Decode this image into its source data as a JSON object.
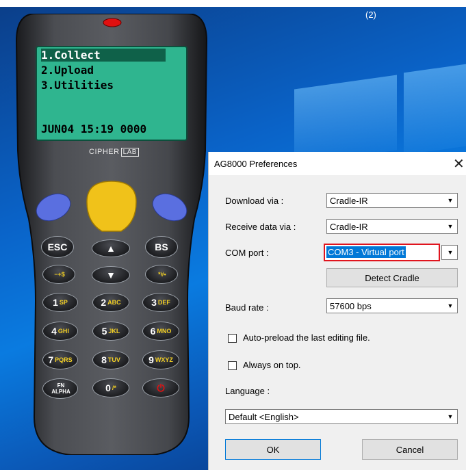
{
  "desktop": {
    "label_count": "(2)"
  },
  "device": {
    "menu": [
      "1.Collect",
      "2.Upload",
      "3.Utilities"
    ],
    "status_line": "JUN04 15:19 0000",
    "brand_name": "CIPHER",
    "brand_lab": "LAB",
    "keys": {
      "esc": "ESC",
      "bs": "BS",
      "minus": "−+$",
      "star": "*#•",
      "k1": "1",
      "k1s": "SP",
      "k2": "2",
      "k2s": "ABC",
      "k3": "3",
      "k3s": "DEF",
      "k4": "4",
      "k4s": "GHI",
      "k5": "5",
      "k5s": "JKL",
      "k6": "6",
      "k6s": "MNO",
      "k7": "7",
      "k7s": "PQRS",
      "k8": "8",
      "k8s": "TUV",
      "k9": "9",
      "k9s": "WXYZ",
      "fn": "FN ALPHA",
      "k0": "0",
      "k0s": "/*",
      "power": "⏻"
    }
  },
  "dialog": {
    "title": "AG8000 Preferences",
    "close": "✕",
    "download_label": "Download via :",
    "download_value": "Cradle-IR",
    "receive_label": "Receive data via :",
    "receive_value": "Cradle-IR",
    "com_label": "COM port :",
    "com_value": "COM3 - Virtual port",
    "detect_button": "Detect Cradle",
    "baud_label": "Baud rate :",
    "baud_value": "57600 bps",
    "autopreload_label": "Auto-preload the last editing file.",
    "ontop_label": "Always on top.",
    "language_label": "Language :",
    "language_value": "Default <English>",
    "ok_button": "OK",
    "cancel_button": "Cancel"
  },
  "colors": {
    "lcd": "#2fb58f",
    "highlight": "#0078d7",
    "red_outline": "#e0141e"
  }
}
